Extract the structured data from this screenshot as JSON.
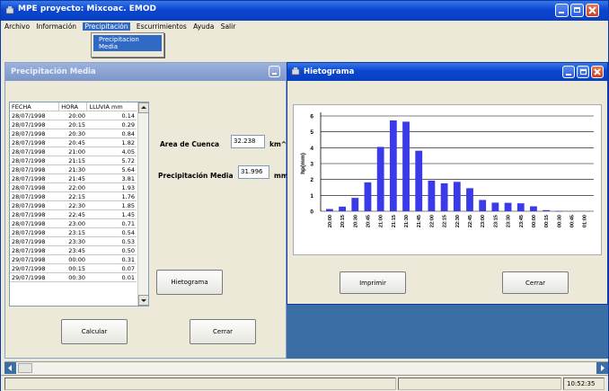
{
  "app": {
    "title": "MPE proyecto: Mixcoac. EMOD",
    "menu": [
      "Archivo",
      "Información",
      "Precipitación",
      "Escurrimientos",
      "Ayuda",
      "Salir"
    ],
    "submenu": [
      "Precipitacion Media"
    ]
  },
  "precip_window": {
    "title": "Precipitación Media",
    "table": {
      "headers": [
        "FECHA",
        "HORA",
        "LLUVIA mm"
      ],
      "rows": [
        [
          "28/07/1998",
          "20:00",
          "0.14"
        ],
        [
          "28/07/1998",
          "20:15",
          "0.29"
        ],
        [
          "28/07/1998",
          "20:30",
          "0.84"
        ],
        [
          "28/07/1998",
          "20:45",
          "1.82"
        ],
        [
          "28/07/1998",
          "21:00",
          "4.05"
        ],
        [
          "28/07/1998",
          "21:15",
          "5.72"
        ],
        [
          "28/07/1998",
          "21:30",
          "5.64"
        ],
        [
          "28/07/1998",
          "21:45",
          "3.81"
        ],
        [
          "28/07/1998",
          "22:00",
          "1.93"
        ],
        [
          "28/07/1998",
          "22:15",
          "1.76"
        ],
        [
          "28/07/1998",
          "22:30",
          "1.85"
        ],
        [
          "28/07/1998",
          "22:45",
          "1.45"
        ],
        [
          "28/07/1998",
          "23:00",
          "0.71"
        ],
        [
          "28/07/1998",
          "23:15",
          "0.54"
        ],
        [
          "28/07/1998",
          "23:30",
          "0.53"
        ],
        [
          "28/07/1998",
          "23:45",
          "0.50"
        ],
        [
          "29/07/1998",
          "00:00",
          "0.31"
        ],
        [
          "29/07/1998",
          "00:15",
          "0.07"
        ],
        [
          "29/07/1998",
          "00:30",
          "0.01"
        ]
      ]
    },
    "area_label": "Area de Cuenca",
    "area_value": "32.238",
    "area_unit": "km^2",
    "precip_label": "Precipitación Media",
    "precip_value": "31.996",
    "precip_unit": "mm",
    "hietograma_button": "Hietograma",
    "calcular_button": "Calcular",
    "cerrar_button": "Cerrar"
  },
  "hietograma_window": {
    "title": "Hietograma",
    "imprimir_button": "Imprimir",
    "cerrar_button": "Cerrar"
  },
  "chart_data": {
    "type": "bar",
    "ylabel": "hp(mm)",
    "ylim": [
      0,
      6
    ],
    "yticks": [
      0,
      1,
      2,
      3,
      4,
      5,
      6
    ],
    "grid": true,
    "categories": [
      "20:00",
      "20:15",
      "20:30",
      "20:45",
      "21:00",
      "21:15",
      "21:30",
      "21:45",
      "22:00",
      "22:15",
      "22:30",
      "22:45",
      "23:00",
      "23:15",
      "23:30",
      "23:45",
      "00:00",
      "00:15",
      "00:30",
      "00:45",
      "01:00"
    ],
    "values": [
      0.14,
      0.29,
      0.84,
      1.82,
      4.05,
      5.72,
      5.64,
      3.81,
      1.93,
      1.76,
      1.85,
      1.45,
      0.71,
      0.54,
      0.53,
      0.5,
      0.31,
      0.07,
      0.01,
      0,
      0
    ],
    "bar_color": "#3a3ae8"
  },
  "statusbar": {
    "time": "10:52:35"
  },
  "colors": {
    "desktop": "#3a6ea5",
    "window_bg": "#ece9d8",
    "title_active": "#0a46d0",
    "title_inactive": "#7b96c8"
  }
}
